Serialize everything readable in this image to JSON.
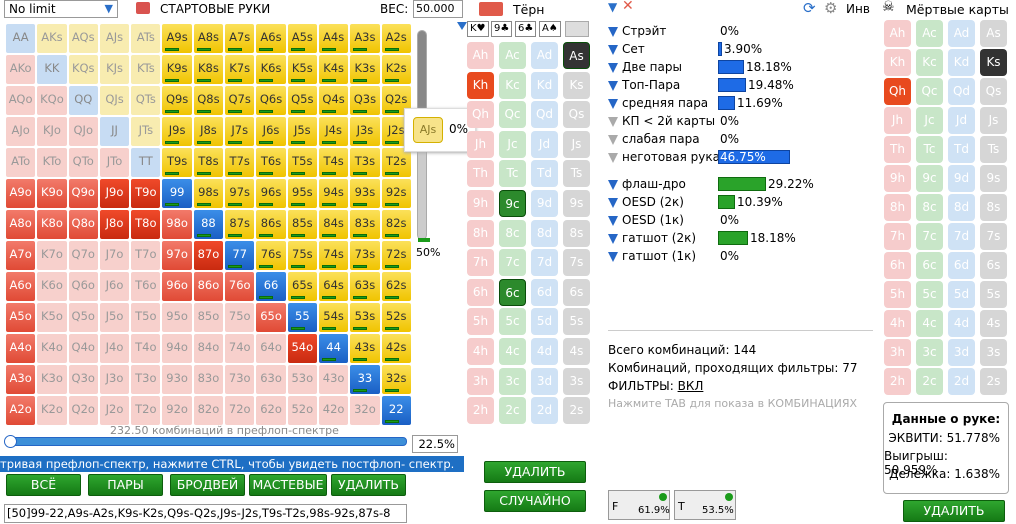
{
  "limit_select": "No limit",
  "start_hands_label": "СТАРТОВЫЕ РУКИ",
  "weight_label": "ВЕС:",
  "weight_value": "50.000",
  "grid": [
    [
      "AA",
      "AKs",
      "AQs",
      "AJs",
      "ATs",
      "A9s",
      "A8s",
      "A7s",
      "A6s",
      "A5s",
      "A4s",
      "A3s",
      "A2s"
    ],
    [
      "AKo",
      "KK",
      "KQs",
      "KJs",
      "KTs",
      "K9s",
      "K8s",
      "K7s",
      "K6s",
      "K5s",
      "K4s",
      "K3s",
      "K2s"
    ],
    [
      "AQo",
      "KQo",
      "QQ",
      "QJs",
      "QTs",
      "Q9s",
      "Q8s",
      "Q7s",
      "Q6s",
      "Q5s",
      "Q4s",
      "Q3s",
      "Q2s"
    ],
    [
      "AJo",
      "KJo",
      "QJo",
      "JJ",
      "JTs",
      "J9s",
      "J8s",
      "J7s",
      "J6s",
      "J5s",
      "J4s",
      "J3s",
      "J2s"
    ],
    [
      "ATo",
      "KTo",
      "QTo",
      "JTo",
      "TT",
      "T9s",
      "T8s",
      "T7s",
      "T6s",
      "T5s",
      "T4s",
      "T3s",
      "T2s"
    ],
    [
      "A9o",
      "K9o",
      "Q9o",
      "J9o",
      "T9o",
      "99",
      "98s",
      "97s",
      "96s",
      "95s",
      "94s",
      "93s",
      "92s"
    ],
    [
      "A8o",
      "K8o",
      "Q8o",
      "J8o",
      "T8o",
      "98o",
      "88",
      "87s",
      "86s",
      "85s",
      "84s",
      "83s",
      "82s"
    ],
    [
      "A7o",
      "K7o",
      "Q7o",
      "J7o",
      "T7o",
      "97o",
      "87o",
      "77",
      "76s",
      "75s",
      "74s",
      "73s",
      "72s"
    ],
    [
      "A6o",
      "K6o",
      "Q6o",
      "J6o",
      "T6o",
      "96o",
      "86o",
      "76o",
      "66",
      "65s",
      "64s",
      "63s",
      "62s"
    ],
    [
      "A5o",
      "K5o",
      "Q5o",
      "J5o",
      "T5o",
      "95o",
      "85o",
      "75o",
      "65o",
      "55",
      "54s",
      "53s",
      "52s"
    ],
    [
      "A4o",
      "K4o",
      "Q4o",
      "J4o",
      "T4o",
      "94o",
      "84o",
      "74o",
      "64o",
      "54o",
      "44",
      "43s",
      "42s"
    ],
    [
      "A3o",
      "K3o",
      "Q3o",
      "J3o",
      "T3o",
      "93o",
      "83o",
      "73o",
      "63o",
      "53o",
      "43o",
      "33",
      "32s"
    ],
    [
      "A2o",
      "K2o",
      "Q2o",
      "J2o",
      "T2o",
      "92o",
      "82o",
      "72o",
      "62o",
      "52o",
      "42o",
      "32o",
      "22"
    ]
  ],
  "hover_cell": "AJs",
  "hover_pct": "0%",
  "slider_pct": "50%",
  "combos_label": "232.50 комбинаций в префлоп-спектре",
  "range_pct": "22.5%",
  "hint_text": "тривая префлоп-спектр, нажмите CTRL, чтобы увидеть постфлоп- спектр.",
  "buttons": {
    "all": "ВСЁ",
    "pairs": "ПАРЫ",
    "broadway": "БРОДВЕЙ",
    "suited": "МАСТЕВЫЕ",
    "delete": "УДАЛИТЬ"
  },
  "range_text": "[50]99-22,A9s-A2s,K9s-K2s,Q9s-Q2s,J9s-J2s,T9s-T2s,98s-92s,87s-8",
  "turn_label": "Тёрн",
  "board": [
    "K♥",
    "9♣",
    "6♣",
    "A♠"
  ],
  "turn_delete": "УДАЛИТЬ",
  "turn_random": "СЛУЧАЙНО",
  "inv_label": "Инв",
  "dead_label": "Мёртвые карты",
  "stats": [
    {
      "name": "Стрэйт",
      "pct": "0%",
      "w": 0,
      "type": "b",
      "funnel": "b"
    },
    {
      "name": "Сет",
      "pct": "3.90%",
      "w": 4,
      "type": "b",
      "funnel": "b"
    },
    {
      "name": "Две пары",
      "pct": "18.18%",
      "w": 26,
      "type": "b",
      "funnel": "b"
    },
    {
      "name": "Топ-Пара",
      "pct": "19.48%",
      "w": 28,
      "type": "b",
      "funnel": "b"
    },
    {
      "name": "средняя пара",
      "pct": "11.69%",
      "w": 17,
      "type": "b",
      "funnel": "b"
    },
    {
      "name": "КП < 2й карты",
      "pct": "0%",
      "w": 0,
      "type": "b",
      "funnel": "g"
    },
    {
      "name": "слабая пара",
      "pct": "0%",
      "w": 0,
      "type": "b",
      "funnel": "g"
    },
    {
      "name": "неготовая рука",
      "pct": "46.75%",
      "w": 72,
      "type": "b",
      "funnel": "g"
    },
    {
      "name": "флаш-дро",
      "pct": "29.22%",
      "w": 48,
      "type": "g",
      "funnel": "b"
    },
    {
      "name": "OESD (2к)",
      "pct": "10.39%",
      "w": 17,
      "type": "g",
      "funnel": "b"
    },
    {
      "name": "OESD (1к)",
      "pct": "0%",
      "w": 0,
      "type": "g",
      "funnel": "b"
    },
    {
      "name": "гатшот (2к)",
      "pct": "18.18%",
      "w": 30,
      "type": "g",
      "funnel": "b"
    },
    {
      "name": "гатшот (1к)",
      "pct": "0%",
      "w": 0,
      "type": "g",
      "funnel": "b"
    }
  ],
  "total_combos": "Всего комбинаций: 144",
  "filtered_combos": "Комбинаций, проходящих фильтры: 77",
  "filters_label": "ФИЛЬТРЫ:",
  "filters_value": "ВКЛ",
  "tab_hint": "Нажмите TAB для показа в КОМБИНАЦИЯХ",
  "f_pct": "61.9%",
  "t_pct": "53.5%",
  "hand_data_title": "Данные о руке:",
  "equity": "ЭКВИТИ: 51.778%",
  "win": "Выигрыш: 50.959%",
  "tie": "Делёжка: 1.638%",
  "dead_delete": "УДАЛИТЬ",
  "ranks": [
    "A",
    "K",
    "Q",
    "J",
    "T",
    "9",
    "8",
    "7",
    "6",
    "5",
    "4",
    "3",
    "2"
  ]
}
